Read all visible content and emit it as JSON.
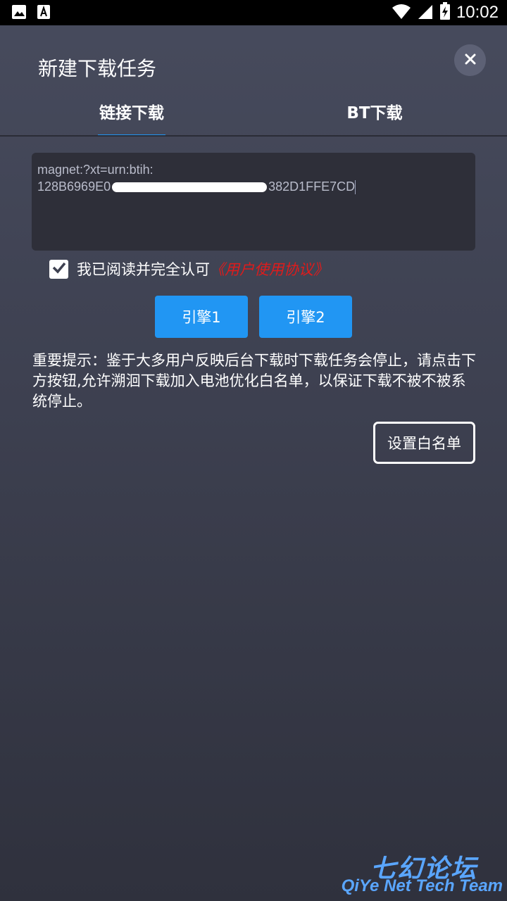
{
  "status_bar": {
    "time": "10:02",
    "icons": [
      "image-icon",
      "font-icon",
      "wifi-icon",
      "signal-icon",
      "battery-charging-icon"
    ]
  },
  "dialog": {
    "title": "新建下载任务",
    "close_icon": "close-icon",
    "tabs": [
      {
        "label": "链接下载",
        "active": true
      },
      {
        "label": "BT下载",
        "active": false
      }
    ]
  },
  "url_input": {
    "line1": "magnet:?xt=urn:btih:",
    "line2_prefix": "128B6969E0",
    "line2_suffix": "382D1FFE7CD"
  },
  "agreement": {
    "checked": true,
    "text": "我已阅读并完全认可",
    "link": "《用户使用协议》"
  },
  "engines": {
    "engine1": "引擎1",
    "engine2": "引擎2"
  },
  "notice": {
    "text": "重要提示：鉴于大多用户反映后台下载时下载任务会停止，请点击下方按钮,允许溯洄下载加入电池优化白名单，以保证下载不被不被系统停止。"
  },
  "whitelist_button": "设置白名单",
  "watermark": {
    "cn": "七幻论坛",
    "en": "QiYe Net Tech Team"
  },
  "colors": {
    "accent": "#2196f3",
    "link": "#e01b1b",
    "background": "#3d4050"
  }
}
